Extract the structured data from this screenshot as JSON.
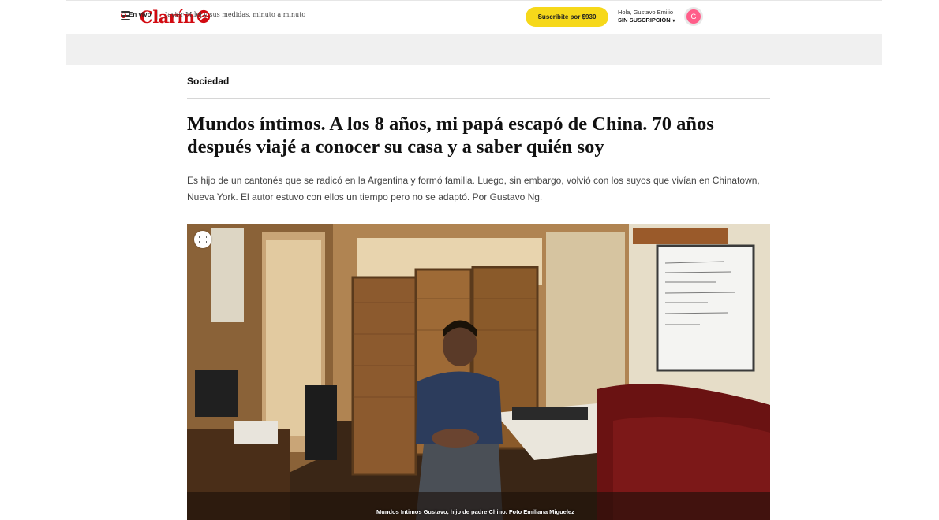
{
  "header": {
    "logo_text": "Clarín",
    "subscribe_label": "Suscribite por $930",
    "greeting": "Hola, Gustavo Emilio",
    "status": "SIN SUSCRIPCIÓN",
    "avatar_initial": "G",
    "brand_color": "#d20a11",
    "subscribe_color": "#f6d81a"
  },
  "live": {
    "label": "En vivo",
    "link_text": "Javier Milei y sus medidas, minuto a minuto"
  },
  "article": {
    "section": "Sociedad",
    "headline": "Mundos íntimos. A los 8 años, mi papá escapó de China. 70 años después viajé a conocer su casa y a saber quién soy",
    "summary": "Es hijo de un cantonés que se radicó en la Argentina y formó familia. Luego, sin embargo, volvió con los suyos que vivían en Chinatown, Nueva York. El autor estuvo con ellos un tiempo pero no se adaptó. Por Gustavo Ng.",
    "image_caption": "Mundos Intimos Gustavo, hijo de padre Chino. Foto Emiliana Miguelez"
  },
  "icons": {
    "menu": "hamburger-menu-icon",
    "expand": "expand-icon",
    "caret": "caret-down-icon"
  }
}
